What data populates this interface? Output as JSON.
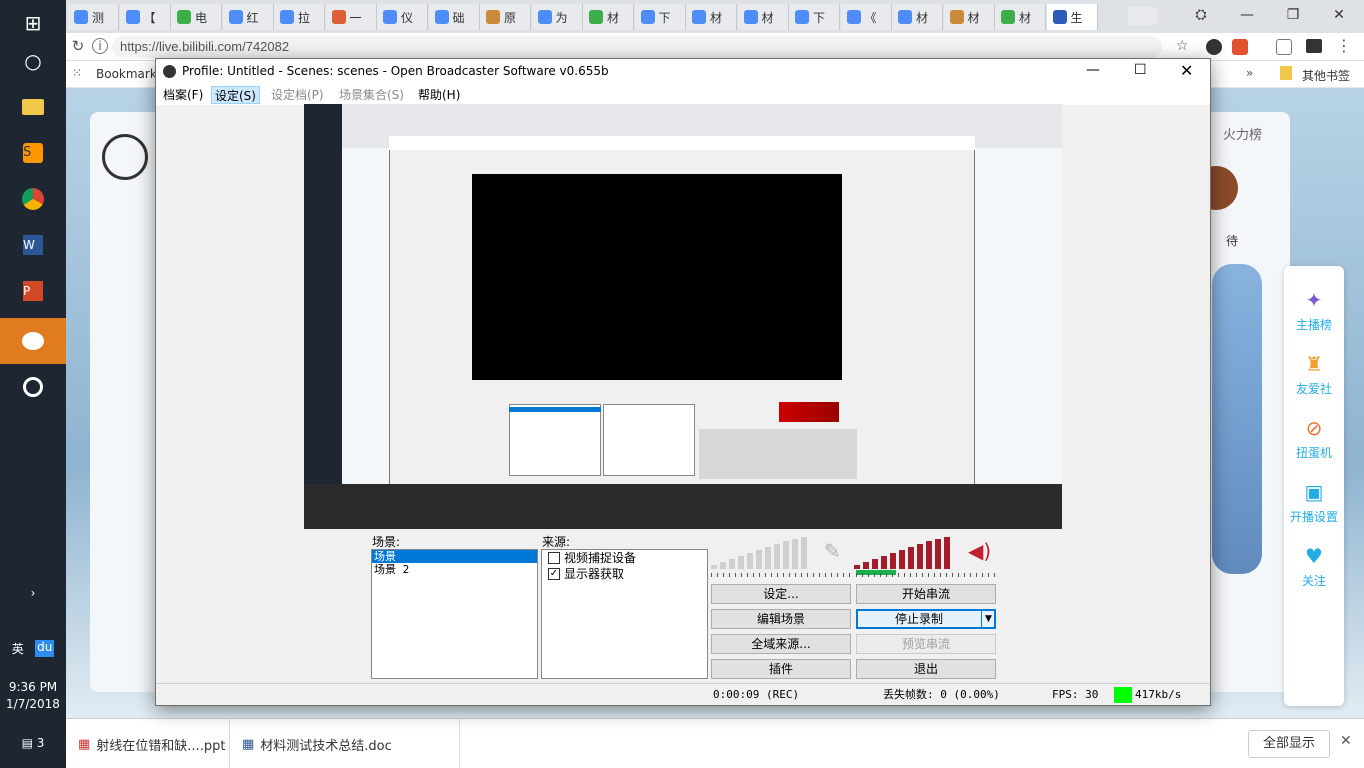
{
  "taskbar": {
    "time": "9:36 PM",
    "date": "1/7/2018",
    "lang": "英",
    "ime": "du",
    "notif_count": "3"
  },
  "browser": {
    "tabs": [
      {
        "label": "测",
        "color": "#4e8cf7"
      },
      {
        "label": "【",
        "color": "#4e8cf7"
      },
      {
        "label": "电",
        "color": "#3cae4a"
      },
      {
        "label": "红",
        "color": "#4e8cf7"
      },
      {
        "label": "拉",
        "color": "#4e8cf7"
      },
      {
        "label": "一",
        "color": "#e05d3a"
      },
      {
        "label": "仪",
        "color": "#4e8cf7"
      },
      {
        "label": "础",
        "color": "#4e8cf7"
      },
      {
        "label": "原",
        "color": "#c98a3a"
      },
      {
        "label": "为",
        "color": "#4e8cf7"
      },
      {
        "label": "材",
        "color": "#3cae4a"
      },
      {
        "label": "下",
        "color": "#4e8cf7"
      },
      {
        "label": "材",
        "color": "#4e8cf7"
      },
      {
        "label": "材",
        "color": "#4e8cf7"
      },
      {
        "label": "下",
        "color": "#4e8cf7"
      },
      {
        "label": "《",
        "color": "#4e8cf7"
      },
      {
        "label": "材",
        "color": "#4e8cf7"
      },
      {
        "label": "材",
        "color": "#c98a3a"
      },
      {
        "label": "材",
        "color": "#3cae4a"
      },
      {
        "label": "生",
        "color": "#2a5cb8"
      }
    ],
    "url": "https://live.bilibili.com/742082",
    "bookmarks_label": "Bookmarks",
    "other_bookmarks": "其他书签"
  },
  "page": {
    "ranking_tab": "火力榜",
    "side": {
      "item1": "主播榜",
      "item2": "友爱社",
      "item3": "扭蛋机",
      "item4": "开播设置",
      "item5": "关注"
    },
    "partial_text": "待"
  },
  "obs": {
    "title": "Profile: Untitled - Scenes: scenes - Open Broadcaster Software v0.655b",
    "menu": {
      "file": "档案(F)",
      "settings": "设定(S)",
      "profiles": "设定档(P)",
      "scene_collection": "场景集合(S)",
      "help": "帮助(H)"
    },
    "scenes_label": "场景:",
    "scenes": [
      "场景",
      "场景 2"
    ],
    "sources_label": "来源:",
    "sources": [
      {
        "label": "视频捕捉设备",
        "checked": false
      },
      {
        "label": "显示器获取",
        "checked": true
      }
    ],
    "buttons": {
      "settings": "设定...",
      "start_stream": "开始串流",
      "edit_scene": "编辑场景",
      "stop_record": "停止录制",
      "global_sources": "全域来源...",
      "preview_stream": "预览串流",
      "plugins": "插件",
      "exit": "退出"
    },
    "status": {
      "time": "0:00:09 (REC)",
      "dropped": "丢失帧数: 0 (0.00%)",
      "fps": "FPS: 30",
      "bitrate": "417kb/s",
      "bitrate_color": "#00ff00"
    }
  },
  "downloads": {
    "item1": "射线在位错和缺....ppt",
    "item2": "材料测试技术总结.doc",
    "show_all": "全部显示"
  }
}
